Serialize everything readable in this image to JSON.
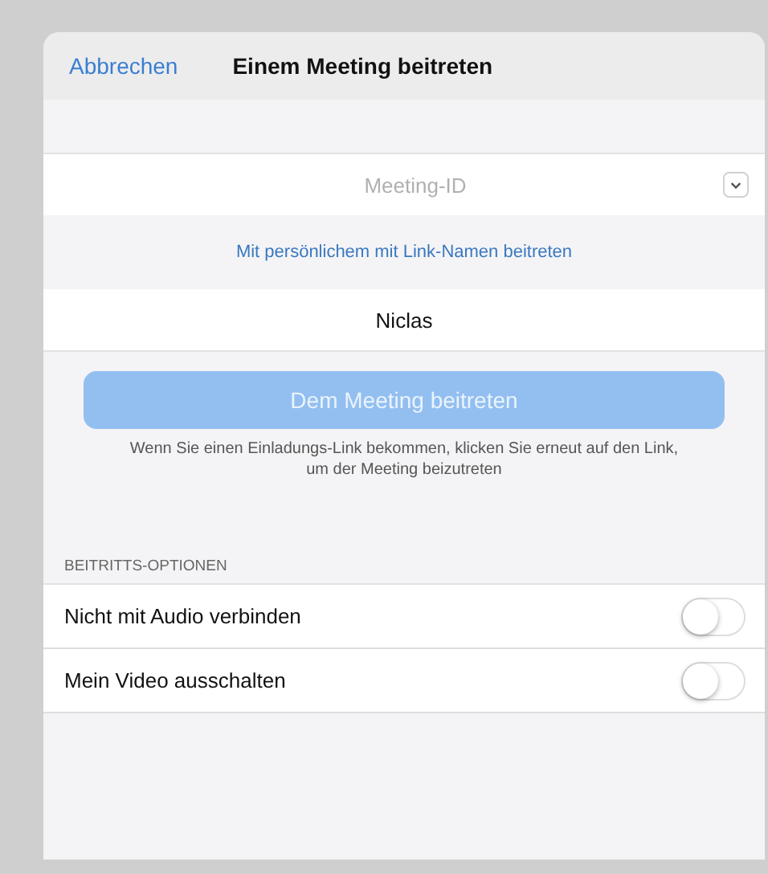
{
  "header": {
    "cancel": "Abbrechen",
    "title": "Einem Meeting beitreten"
  },
  "meeting_id": {
    "placeholder": "Meeting-ID"
  },
  "link": "Mit persönlichem mit Link-Namen beitreten",
  "name_field": {
    "value": "Niclas"
  },
  "join_button": {
    "label": "Dem Meeting beitreten",
    "disabled": true
  },
  "hint": "Wenn Sie einen Einladungs-Link bekommen, klicken Sie erneut auf den Link, um der Meeting beizutreten",
  "options": {
    "heading": "BEITRITTS-OPTIONEN",
    "items": [
      {
        "label": "Nicht mit Audio verbinden",
        "on": false
      },
      {
        "label": "Mein Video ausschalten",
        "on": false
      }
    ]
  }
}
